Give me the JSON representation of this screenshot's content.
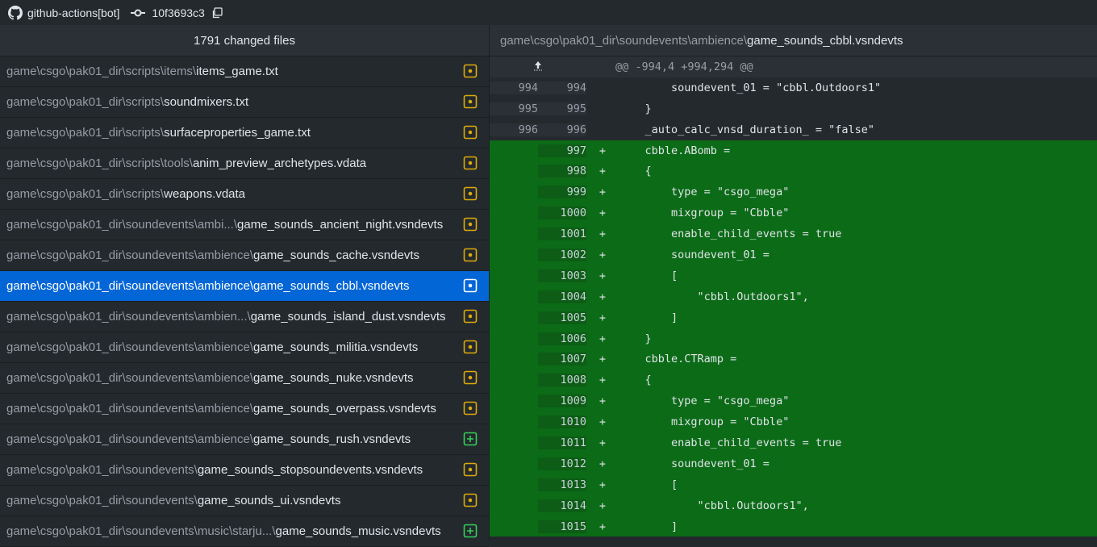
{
  "topbar": {
    "author": "github-actions[bot]",
    "sha": "10f3693c3"
  },
  "files_panel": {
    "header": "1791 changed files",
    "files": [
      {
        "dir": "game\\csgo\\pak01_dir\\scripts\\items\\",
        "name": "items_game.txt",
        "status": "modified"
      },
      {
        "dir": "game\\csgo\\pak01_dir\\scripts\\",
        "name": "soundmixers.txt",
        "status": "modified"
      },
      {
        "dir": "game\\csgo\\pak01_dir\\scripts\\",
        "name": "surfaceproperties_game.txt",
        "status": "modified"
      },
      {
        "dir": "game\\csgo\\pak01_dir\\scripts\\tools\\",
        "name": "anim_preview_archetypes.vdata",
        "status": "modified"
      },
      {
        "dir": "game\\csgo\\pak01_dir\\scripts\\",
        "name": "weapons.vdata",
        "status": "modified"
      },
      {
        "dir": "game\\csgo\\pak01_dir\\soundevents\\ambi...\\",
        "name": "game_sounds_ancient_night.vsndevts",
        "status": "modified"
      },
      {
        "dir": "game\\csgo\\pak01_dir\\soundevents\\ambience\\",
        "name": "game_sounds_cache.vsndevts",
        "status": "modified"
      },
      {
        "dir": "game\\csgo\\pak01_dir\\soundevents\\ambience\\",
        "name": "game_sounds_cbbl.vsndevts",
        "status": "modified",
        "selected": true
      },
      {
        "dir": "game\\csgo\\pak01_dir\\soundevents\\ambien...\\",
        "name": "game_sounds_island_dust.vsndevts",
        "status": "modified"
      },
      {
        "dir": "game\\csgo\\pak01_dir\\soundevents\\ambience\\",
        "name": "game_sounds_militia.vsndevts",
        "status": "modified"
      },
      {
        "dir": "game\\csgo\\pak01_dir\\soundevents\\ambience\\",
        "name": "game_sounds_nuke.vsndevts",
        "status": "modified"
      },
      {
        "dir": "game\\csgo\\pak01_dir\\soundevents\\ambience\\",
        "name": "game_sounds_overpass.vsndevts",
        "status": "modified"
      },
      {
        "dir": "game\\csgo\\pak01_dir\\soundevents\\ambience\\",
        "name": "game_sounds_rush.vsndevts",
        "status": "added"
      },
      {
        "dir": "game\\csgo\\pak01_dir\\soundevents\\",
        "name": "game_sounds_stopsoundevents.vsndevts",
        "status": "modified"
      },
      {
        "dir": "game\\csgo\\pak01_dir\\soundevents\\",
        "name": "game_sounds_ui.vsndevts",
        "status": "modified"
      },
      {
        "dir": "game\\csgo\\pak01_dir\\soundevents\\music\\starju...\\",
        "name": "game_sounds_music.vsndevts",
        "status": "added"
      }
    ]
  },
  "diff_panel": {
    "path_dir": "game\\csgo\\pak01_dir\\soundevents\\ambience\\",
    "path_name": "game_sounds_cbbl.vsndevts",
    "hunk_header": "@@ -994,4 +994,294 @@",
    "lines": [
      {
        "type": "ctx",
        "old": "994",
        "new": "994",
        "sign": "",
        "code": "        soundevent_01 = \"cbbl.Outdoors1\""
      },
      {
        "type": "ctx",
        "old": "995",
        "new": "995",
        "sign": "",
        "code": "    }"
      },
      {
        "type": "ctx",
        "old": "996",
        "new": "996",
        "sign": "",
        "code": "    _auto_calc_vnsd_duration_ = \"false\""
      },
      {
        "type": "add",
        "old": "",
        "new": "997",
        "sign": "+",
        "code": "    cbble.ABomb ="
      },
      {
        "type": "add",
        "old": "",
        "new": "998",
        "sign": "+",
        "code": "    {"
      },
      {
        "type": "add",
        "old": "",
        "new": "999",
        "sign": "+",
        "code": "        type = \"csgo_mega\""
      },
      {
        "type": "add",
        "old": "",
        "new": "1000",
        "sign": "+",
        "code": "        mixgroup = \"Cbble\""
      },
      {
        "type": "add",
        "old": "",
        "new": "1001",
        "sign": "+",
        "code": "        enable_child_events = true"
      },
      {
        "type": "add",
        "old": "",
        "new": "1002",
        "sign": "+",
        "code": "        soundevent_01 ="
      },
      {
        "type": "add",
        "old": "",
        "new": "1003",
        "sign": "+",
        "code": "        ["
      },
      {
        "type": "add",
        "old": "",
        "new": "1004",
        "sign": "+",
        "code": "            \"cbbl.Outdoors1\","
      },
      {
        "type": "add",
        "old": "",
        "new": "1005",
        "sign": "+",
        "code": "        ]"
      },
      {
        "type": "add",
        "old": "",
        "new": "1006",
        "sign": "+",
        "code": "    }"
      },
      {
        "type": "add",
        "old": "",
        "new": "1007",
        "sign": "+",
        "code": "    cbble.CTRamp ="
      },
      {
        "type": "add",
        "old": "",
        "new": "1008",
        "sign": "+",
        "code": "    {"
      },
      {
        "type": "add",
        "old": "",
        "new": "1009",
        "sign": "+",
        "code": "        type = \"csgo_mega\""
      },
      {
        "type": "add",
        "old": "",
        "new": "1010",
        "sign": "+",
        "code": "        mixgroup = \"Cbble\""
      },
      {
        "type": "add",
        "old": "",
        "new": "1011",
        "sign": "+",
        "code": "        enable_child_events = true"
      },
      {
        "type": "add",
        "old": "",
        "new": "1012",
        "sign": "+",
        "code": "        soundevent_01 ="
      },
      {
        "type": "add",
        "old": "",
        "new": "1013",
        "sign": "+",
        "code": "        ["
      },
      {
        "type": "add",
        "old": "",
        "new": "1014",
        "sign": "+",
        "code": "            \"cbbl.Outdoors1\","
      },
      {
        "type": "add",
        "old": "",
        "new": "1015",
        "sign": "+",
        "code": "        ]"
      }
    ]
  },
  "colors": {
    "modified": "#dbab09",
    "added": "#34d058",
    "selected": "#0366d6",
    "added_line": "#0b6b17"
  },
  "icons": {
    "author": "github-icon",
    "commit": "git-commit-icon",
    "copy": "copy-icon",
    "expand": "expand-up-icon",
    "modified": "file-modified-icon",
    "added": "file-added-icon"
  }
}
